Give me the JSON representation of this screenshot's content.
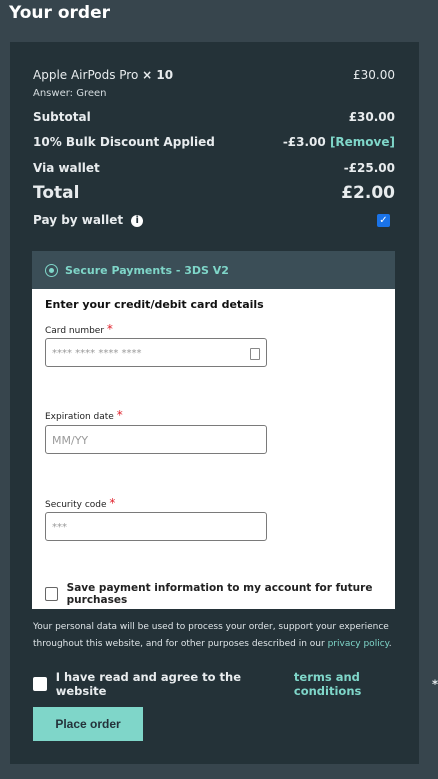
{
  "page": {
    "title": "Your order"
  },
  "order": {
    "product_name": "Apple AirPods Pro",
    "quantity": "× 10",
    "product_price": "£30.00",
    "answer": "Answer: Green",
    "subtotal_label": "Subtotal",
    "subtotal_value": "£30.00",
    "discount_label": "10% Bulk Discount Applied",
    "discount_value": "-£3.00",
    "remove_label": "[Remove]",
    "wallet_label": "Via wallet",
    "wallet_value": "-£25.00",
    "total_label": "Total",
    "total_value": "£2.00",
    "pay_by_wallet_label": "Pay by wallet",
    "pay_by_wallet_checked": true
  },
  "payment": {
    "method_label": "Secure Payments - 3DS V2",
    "card_heading": "Enter your credit/debit card details",
    "card_number_label": "Card number",
    "card_number_placeholder": "**** **** **** ****",
    "expiration_label": "Expiration date",
    "expiration_placeholder": "MM/YY",
    "security_label": "Security code",
    "security_placeholder": "***",
    "save_label": "Save payment information to my account for future purchases",
    "required_mark": "*"
  },
  "footer": {
    "privacy_text": "Your personal data will be used to process your order, support your experience throughout this website, and for other purposes described in our",
    "privacy_link": "privacy policy",
    "privacy_end": ".",
    "terms_text": "I have read and agree to the website",
    "terms_link": "terms and conditions",
    "terms_required": "*",
    "place_order_label": "Place order"
  },
  "colors": {
    "accent": "#7fd6c9",
    "panel": "#243238",
    "background": "#37454d",
    "checkbox_checked": "#1a73e8"
  },
  "icons": [
    "info-icon",
    "radio-selected-icon",
    "card-lock-icon",
    "checkbox-icon"
  ]
}
